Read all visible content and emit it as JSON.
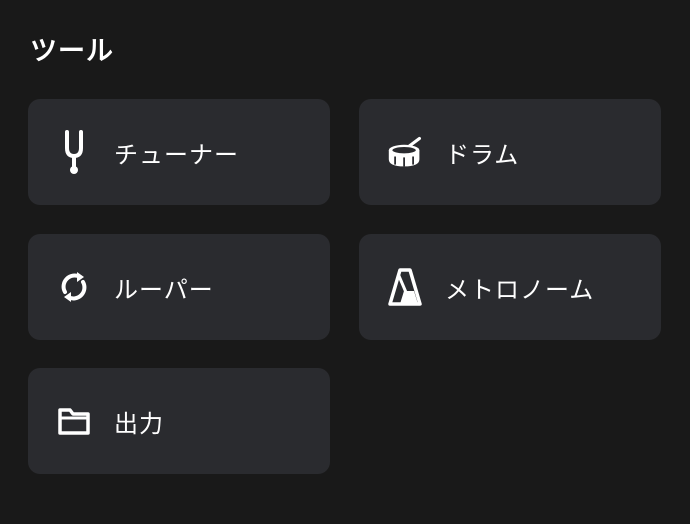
{
  "section": {
    "title": "ツール"
  },
  "tools": [
    {
      "label": "チューナー",
      "icon": "tuning-fork-icon"
    },
    {
      "label": "ドラム",
      "icon": "drum-icon"
    },
    {
      "label": "ルーパー",
      "icon": "loop-icon"
    },
    {
      "label": "メトロノーム",
      "icon": "metronome-icon"
    },
    {
      "label": "出力",
      "icon": "folder-icon"
    }
  ],
  "colors": {
    "background": "#191919",
    "card": "#2a2b2f",
    "text": "#ffffff"
  }
}
